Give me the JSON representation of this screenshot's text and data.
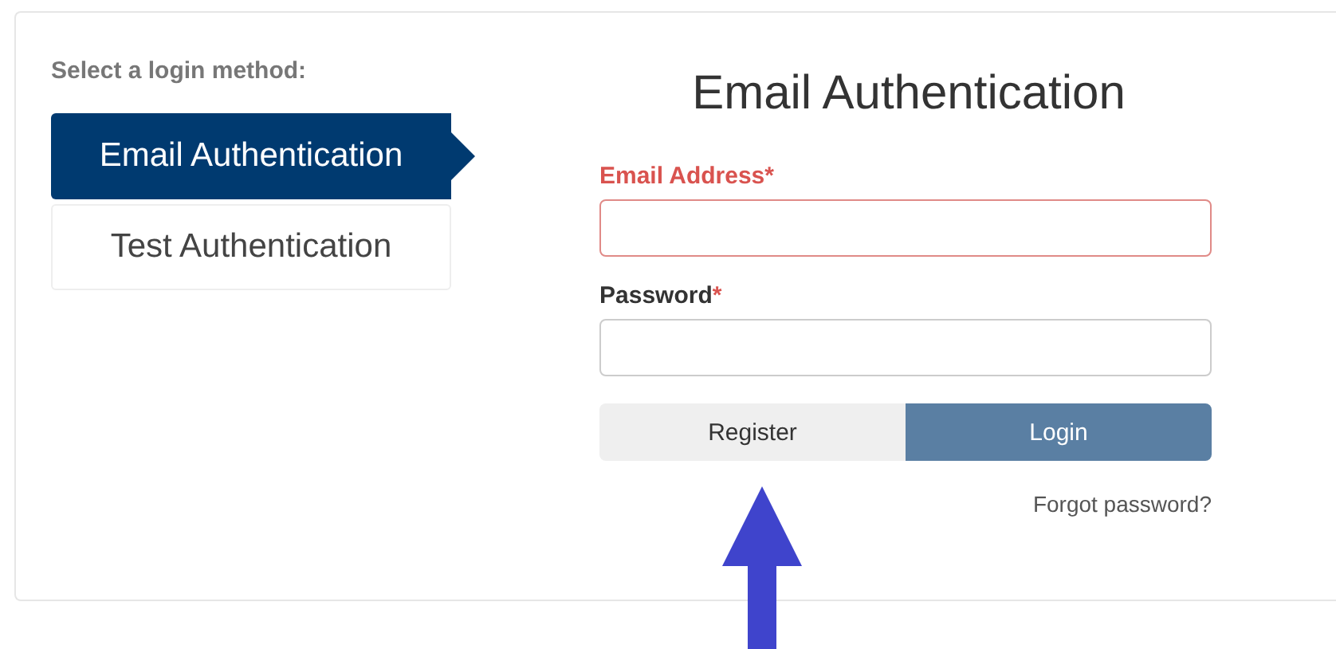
{
  "method_prompt": "Select a login method:",
  "methods": [
    {
      "label": "Email Authentication",
      "selected": true
    },
    {
      "label": "Test Authentication",
      "selected": false
    }
  ],
  "form": {
    "title": "Email Authentication",
    "fields": [
      {
        "label": "Email Address",
        "required_mark": "*",
        "invalid": true
      },
      {
        "label": "Password",
        "required_mark": "*",
        "invalid": false
      }
    ],
    "buttons": [
      {
        "label": "Register",
        "kind": "secondary"
      },
      {
        "label": "Login",
        "kind": "primary"
      }
    ],
    "forgot_link": "Forgot password?"
  }
}
